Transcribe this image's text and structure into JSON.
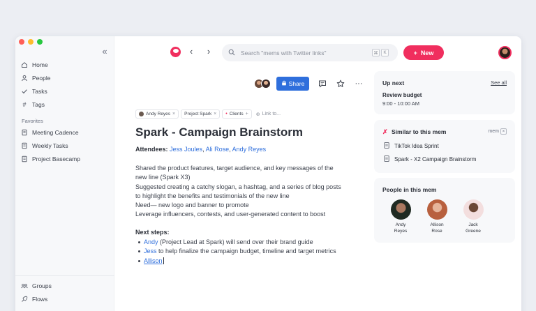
{
  "window": {
    "traffic_colors": [
      "#ff5f57",
      "#febc2e",
      "#28c840"
    ]
  },
  "sidebar": {
    "collapse_icon": "double-chevron-left-icon",
    "nav": [
      {
        "label": "Home",
        "icon": "home-icon"
      },
      {
        "label": "People",
        "icon": "person-icon"
      },
      {
        "label": "Tasks",
        "icon": "check-icon"
      },
      {
        "label": "Tags",
        "icon": "hash-icon"
      }
    ],
    "favorites_label": "Favorites",
    "favorites": [
      {
        "label": "Meeting Cadence",
        "icon": "document-icon"
      },
      {
        "label": "Weekly Tasks",
        "icon": "document-icon"
      },
      {
        "label": "Project Basecamp",
        "icon": "document-icon"
      }
    ],
    "bottom": [
      {
        "label": "Groups",
        "icon": "groups-icon"
      },
      {
        "label": "Flows",
        "icon": "flows-icon"
      }
    ]
  },
  "topbar": {
    "search_placeholder": "Search \"mems with Twitter links\"",
    "shortcut_keys": [
      "⌘",
      "K"
    ],
    "new_label": "New",
    "accent_color": "#f02e5e"
  },
  "toolbar": {
    "share_label": "Share"
  },
  "doc": {
    "tags": [
      "Andy Reyes",
      "Project Spark",
      "Clients"
    ],
    "link_to": "Link to...",
    "title": "Spark - Campaign Brainstorm",
    "attendees_label": "Attendees:",
    "attendees": [
      "Jess Joules",
      "Ali Rose",
      "Andy Reyes"
    ],
    "paragraph_lines": [
      "Shared the product features, target audience, and key messages of the",
      "new line (Spark X3)",
      "Suggested creating a catchy slogan, a hashtag, and a series of blog posts",
      "to highlight the benefits and testimonials of the new line",
      "Need— new logo and banner to promote",
      "Leverage influencers, contests, and user-generated content to boost"
    ],
    "next_steps_label": "Next steps:",
    "steps": [
      {
        "name": "Andy",
        "text": " (Project Lead at Spark) will send over their brand guide"
      },
      {
        "name": "Jess",
        "text": " to help finalize the campaign budget, timeline and target metrics"
      },
      {
        "name": "Allison",
        "text": ""
      }
    ],
    "link_color": "#2f6fdc"
  },
  "up_next": {
    "title": "Up next",
    "see_all": "See all",
    "event_title": "Review budget",
    "event_time": "9:00 - 10:00 AM"
  },
  "similar": {
    "title": "Similar to this mem",
    "shortcut": "mem",
    "items": [
      "TikTok Idea Sprint",
      "Spark - X2 Campaign Brainstorm"
    ]
  },
  "people": {
    "title": "People in this mem",
    "list": [
      {
        "name_line1": "Andy",
        "name_line2": "Reyes"
      },
      {
        "name_line1": "Allison",
        "name_line2": "Rose"
      },
      {
        "name_line1": "Jack",
        "name_line2": "Greene"
      }
    ]
  }
}
